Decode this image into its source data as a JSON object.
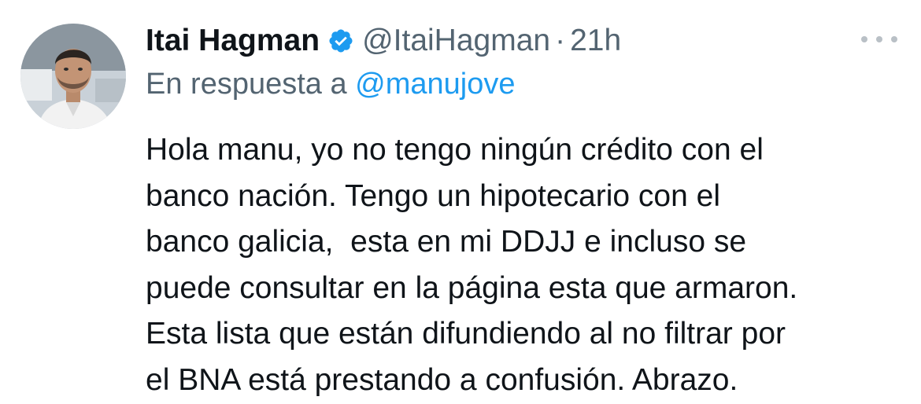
{
  "tweet": {
    "author": {
      "display_name": "Itai Hagman",
      "handle": "@ItaiHagman",
      "verified": true,
      "avatar_icon": "profile-photo"
    },
    "separator": "·",
    "time": "21h",
    "more_icon": "more-horizontal-icon",
    "reply": {
      "prefix": "En respuesta a",
      "target": "@manujove"
    },
    "body_lines": [
      "Hola manu, yo no tengo ningún crédito con el",
      "banco nación. Tengo un hipotecario con el",
      "banco galicia,  esta en mi DDJJ e incluso se",
      "puede consultar en la página esta que armaron.",
      "Esta lista que están difundiendo al no filtrar por",
      "el BNA está prestando a confusión. Abrazo."
    ]
  },
  "colors": {
    "text": "#0f1419",
    "secondary": "#536471",
    "link": "#1d9bf0",
    "verified": "#1d9bf0",
    "background": "#ffffff"
  }
}
